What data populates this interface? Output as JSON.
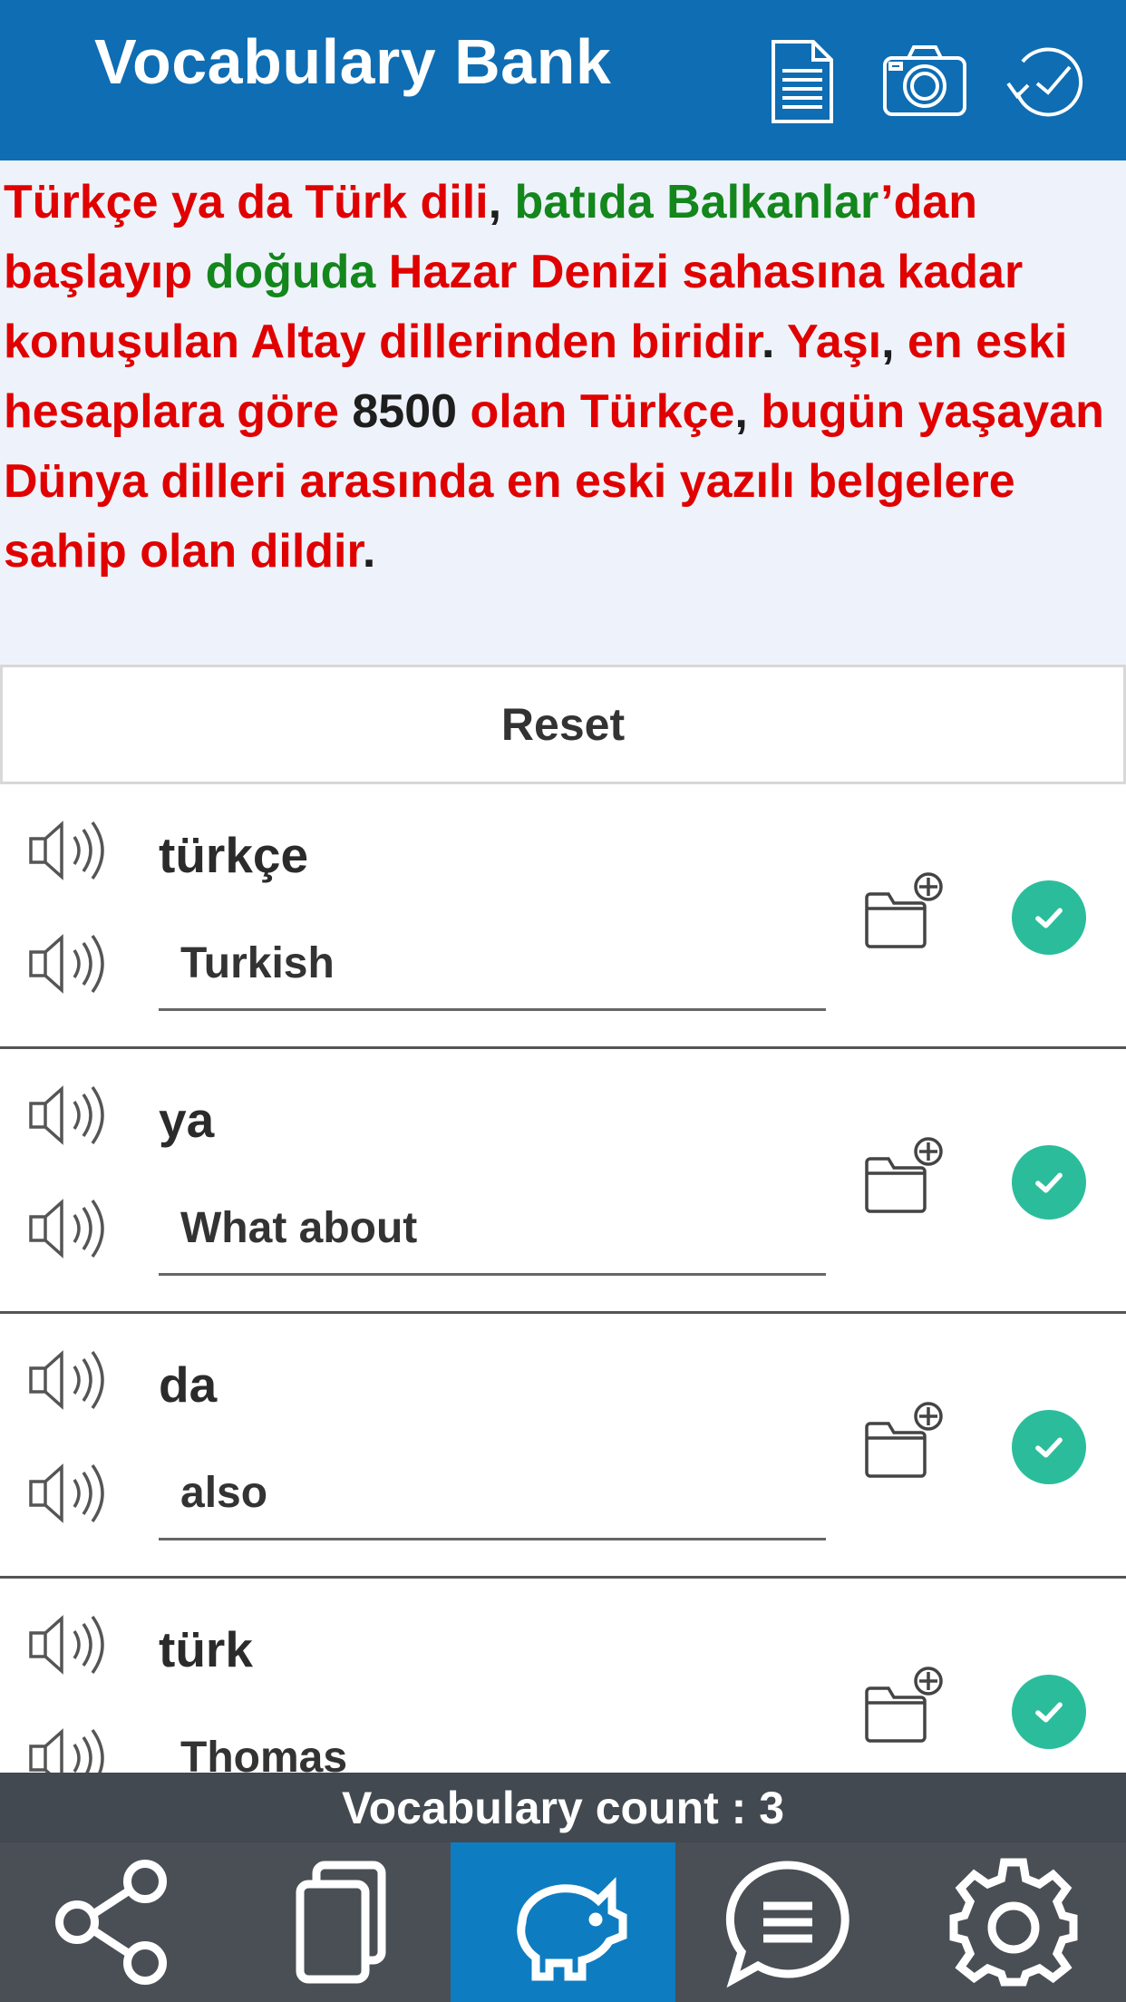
{
  "header": {
    "title": "Vocabulary Bank",
    "icons": [
      "document-icon",
      "camera-icon",
      "history-icon"
    ]
  },
  "passage": {
    "segments": [
      {
        "text": "Türkçe ya da Türk dili",
        "color": "red"
      },
      {
        "text": ", ",
        "color": "dark"
      },
      {
        "text": "batıda Balkanlar",
        "color": "green"
      },
      {
        "text": "’dan",
        "color": "red"
      },
      {
        "text": " başlayıp ",
        "color": "red"
      },
      {
        "text": "doğuda",
        "color": "green"
      },
      {
        "text": " Hazar Denizi sahasına kadar konuşulan Altay dillerinden biridir",
        "color": "red"
      },
      {
        "text": ". ",
        "color": "dark"
      },
      {
        "text": "Yaşı",
        "color": "red"
      },
      {
        "text": ", ",
        "color": "dark"
      },
      {
        "text": "en eski hesaplara göre ",
        "color": "red"
      },
      {
        "text": "8500",
        "color": "dark"
      },
      {
        "text": " olan Türkçe",
        "color": "red"
      },
      {
        "text": ", ",
        "color": "dark"
      },
      {
        "text": "bugün yaşayan Dünya dilleri arasında en eski yazılı belgelere sahip olan dildir",
        "color": "red"
      },
      {
        "text": ".",
        "color": "dark"
      }
    ],
    "colors": {
      "red": "#e00000",
      "green": "#13861c",
      "dark": "#1e1e1e"
    }
  },
  "reset_label": "Reset",
  "words": [
    {
      "word": "türkçe",
      "meaning": "Turkish"
    },
    {
      "word": "ya",
      "meaning": "What about"
    },
    {
      "word": "da",
      "meaning": "also"
    },
    {
      "word": "türk",
      "meaning": "Thomas"
    }
  ],
  "count_label": "Vocabulary count : 3",
  "nav": {
    "tabs": [
      {
        "name": "share-icon",
        "active": false
      },
      {
        "name": "copy-icon",
        "active": false
      },
      {
        "name": "piggy-bank-icon",
        "active": true
      },
      {
        "name": "chat-icon",
        "active": false
      },
      {
        "name": "settings-icon",
        "active": false
      }
    ]
  },
  "colors": {
    "header": "#0e6db3",
    "check": "#2bbd9b",
    "active_tab": "#0e7cc1",
    "nav_bg": "#4a4f55"
  }
}
